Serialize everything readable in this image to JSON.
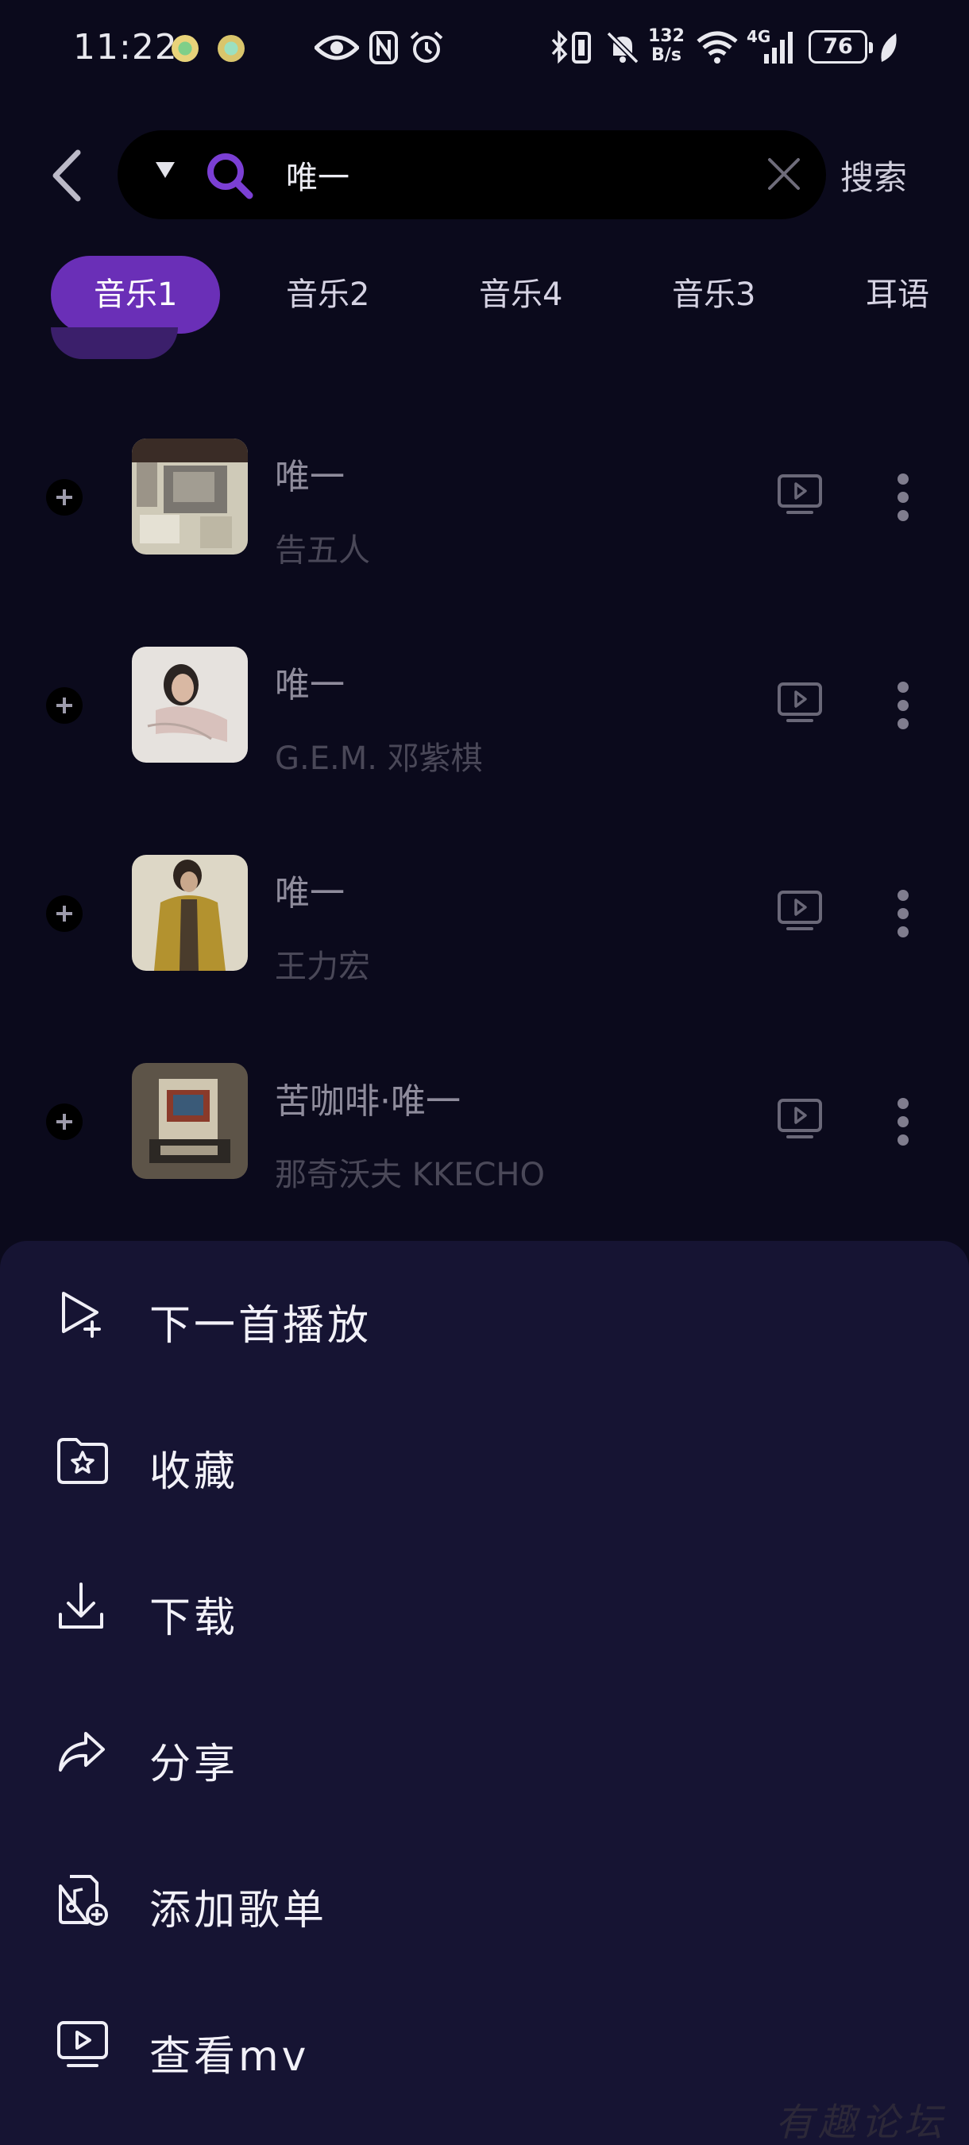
{
  "status_bar": {
    "time": "11:22",
    "net_speed_value": "132",
    "net_speed_unit": "B/s",
    "network": "4G",
    "battery": "76",
    "icons": [
      "app-icon",
      "app-icon",
      "eye-icon",
      "nfc-icon",
      "alarm-icon",
      "bluetooth-icon",
      "vibrate-icon",
      "mute-icon",
      "wifi-icon",
      "signal-icon",
      "battery-icon",
      "leaf-icon"
    ]
  },
  "search": {
    "value": "唯一",
    "button_label": "搜索"
  },
  "tabs": [
    {
      "label": "音乐1",
      "active": true
    },
    {
      "label": "音乐2",
      "active": false
    },
    {
      "label": "音乐4",
      "active": false
    },
    {
      "label": "音乐3",
      "active": false
    },
    {
      "label": "耳语",
      "active": false
    }
  ],
  "songs": [
    {
      "title": "唯一",
      "artist": "告五人"
    },
    {
      "title": "唯一",
      "artist": "G.E.M. 邓紫棋"
    },
    {
      "title": "唯一",
      "artist": "王力宏"
    },
    {
      "title": "苦咖啡·唯一",
      "artist": "那奇沃夫 KKECHO"
    }
  ],
  "sheet": {
    "items": [
      {
        "label": "下一首播放",
        "icon": "play-next-icon"
      },
      {
        "label": "收藏",
        "icon": "favorite-folder-icon"
      },
      {
        "label": "下载",
        "icon": "download-icon"
      },
      {
        "label": "分享",
        "icon": "share-icon"
      },
      {
        "label": "添加歌单",
        "icon": "add-playlist-icon"
      },
      {
        "label": "查看mv",
        "icon": "mv-icon"
      }
    ]
  },
  "watermark": "有趣论坛",
  "colors": {
    "background": "#0b0a1c",
    "accent": "#6a2fb7",
    "sheet": "#161433"
  }
}
